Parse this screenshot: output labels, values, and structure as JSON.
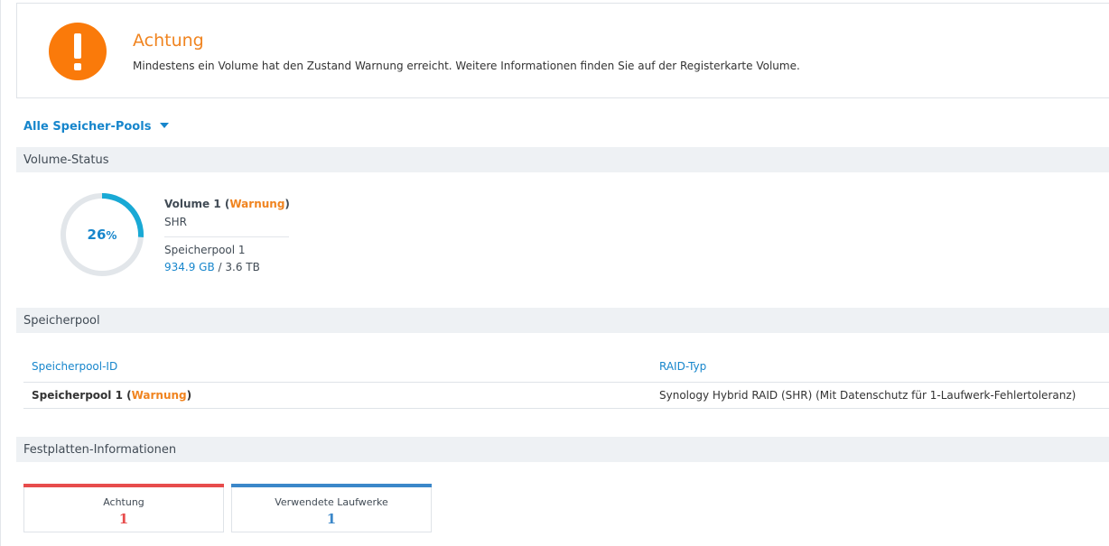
{
  "alert": {
    "title": "Achtung",
    "message": "Mindestens ein Volume hat den Zustand Warnung erreicht. Weitere Informationen finden Sie auf der Registerkarte Volume.",
    "icon": "exclamation-icon",
    "color": "#fa7a0a"
  },
  "pool_selector": {
    "label": "Alle Speicher-Pools",
    "icon": "caret-down-icon"
  },
  "volume_status": {
    "heading": "Volume-Status",
    "usage_percent": 26,
    "usage_number": "26",
    "usage_unit": "%",
    "name": "Volume 1",
    "status": "Warnung",
    "type": "SHR",
    "pool": "Speicherpool 1",
    "used": "934.9 GB",
    "total": "3.6 TB",
    "ring_color": "#19a9d5",
    "track_color": "#e2e6ea"
  },
  "storage_pool": {
    "heading": "Speicherpool",
    "columns": [
      "Speicherpool-ID",
      "RAID-Typ"
    ],
    "rows": [
      {
        "id": "Speicherpool 1",
        "status": "Warnung",
        "raid": "Synology Hybrid RAID (SHR) (Mit Datenschutz für 1-Laufwerk-Fehlertoleranz)"
      }
    ]
  },
  "disk_info": {
    "heading": "Festplatten-Informationen",
    "cards": [
      {
        "label": "Achtung",
        "value": "1",
        "color": "#e74c4c"
      },
      {
        "label": "Verwendete Laufwerke",
        "value": "1",
        "color": "#3b87c9"
      }
    ]
  },
  "colors": {
    "accent": "#1786cc",
    "warning": "#f08420"
  }
}
